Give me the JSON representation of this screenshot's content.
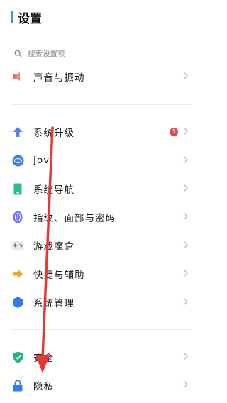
{
  "header": {
    "title": "设置"
  },
  "search": {
    "placeholder": "搜索设置项"
  },
  "sections": [
    {
      "items": [
        {
          "label": "声音与振动",
          "icon": "speaker-icon"
        }
      ]
    },
    {
      "items": [
        {
          "label": "系统升级",
          "icon": "upgrade-arrow-icon",
          "badge": "1"
        },
        {
          "label": "Jovi",
          "icon": "jovi-icon"
        },
        {
          "label": "系统导航",
          "icon": "phone-navigation-icon"
        },
        {
          "label": "指纹、面部与密码",
          "icon": "fingerprint-icon"
        },
        {
          "label": "游戏魔盒",
          "icon": "game-box-icon"
        },
        {
          "label": "快捷与辅助",
          "icon": "shortcut-arrow-icon"
        },
        {
          "label": "系统管理",
          "icon": "hexagon-icon"
        }
      ]
    },
    {
      "items": [
        {
          "label": "安全",
          "icon": "shield-icon"
        },
        {
          "label": "隐私",
          "icon": "lock-icon"
        }
      ]
    }
  ],
  "colors": {
    "accent": "#3a8ef6",
    "badge": "#e9474a",
    "annotation_arrow": "#e53935"
  }
}
